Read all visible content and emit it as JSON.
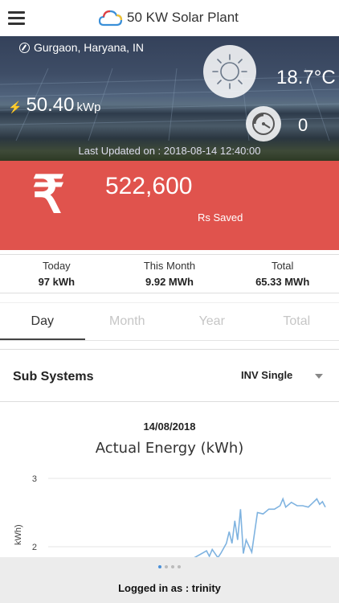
{
  "header": {
    "title": "50 KW Solar Plant"
  },
  "plant": {
    "location": "Gurgaon, Haryana, IN",
    "temperature": "18.7",
    "temperature_unit": "°C",
    "capacity_value": "50.40",
    "capacity_unit": "kWp",
    "gauge_value": "0",
    "last_updated": "Last Updated on : 2018-08-14 12:40:00"
  },
  "savings": {
    "currency_symbol": "₹",
    "amount": "522,600",
    "label": "Rs Saved"
  },
  "stats": [
    {
      "label": "Today",
      "value": "97 kWh"
    },
    {
      "label": "This Month",
      "value": "9.92 MWh"
    },
    {
      "label": "Total",
      "value": "65.33 MWh"
    }
  ],
  "tabs": [
    {
      "label": "Day",
      "active": true
    },
    {
      "label": "Month",
      "active": false
    },
    {
      "label": "Year",
      "active": false
    },
    {
      "label": "Total",
      "active": false
    }
  ],
  "subsystems": {
    "label": "Sub Systems",
    "selected": "INV Single"
  },
  "chart_section": {
    "date": "14/08/2018"
  },
  "chart_data": {
    "type": "line",
    "title": "Actual Energy (kWh)",
    "ylabel": "kWh)",
    "ytick_labels": [
      "3",
      "2"
    ],
    "ylim": [
      1.8,
      3.0
    ],
    "grid": true,
    "series": [
      {
        "color": "#7fb3e0",
        "points": [
          [
            0.0,
            1.8
          ],
          [
            0.5,
            1.8
          ],
          [
            0.56,
            1.94
          ],
          [
            0.57,
            1.86
          ],
          [
            0.58,
            1.96
          ],
          [
            0.6,
            1.84
          ],
          [
            0.61,
            1.9
          ],
          [
            0.63,
            2.05
          ],
          [
            0.64,
            2.22
          ],
          [
            0.65,
            2.05
          ],
          [
            0.66,
            2.38
          ],
          [
            0.67,
            2.1
          ],
          [
            0.68,
            2.55
          ],
          [
            0.69,
            1.9
          ],
          [
            0.7,
            2.1
          ],
          [
            0.72,
            1.92
          ],
          [
            0.74,
            2.5
          ],
          [
            0.76,
            2.48
          ],
          [
            0.78,
            2.55
          ],
          [
            0.8,
            2.55
          ],
          [
            0.82,
            2.6
          ],
          [
            0.83,
            2.7
          ],
          [
            0.84,
            2.58
          ],
          [
            0.86,
            2.65
          ],
          [
            0.88,
            2.6
          ],
          [
            0.9,
            2.6
          ],
          [
            0.92,
            2.58
          ],
          [
            0.94,
            2.66
          ],
          [
            0.95,
            2.7
          ],
          [
            0.96,
            2.62
          ],
          [
            0.97,
            2.66
          ],
          [
            0.98,
            2.58
          ]
        ]
      }
    ]
  },
  "footer": {
    "logged_in": "Logged in as : trinity"
  },
  "theme": {
    "savings_bg": "#e0534d",
    "chart_line": "#7fb3e0",
    "pager_active": "#4a90d9"
  },
  "icons": [
    "menu-icon",
    "cloud-logo-icon",
    "location-icon",
    "sun-icon",
    "lightning-icon",
    "gauge-icon",
    "rupee-icon",
    "chevron-down-icon"
  ]
}
